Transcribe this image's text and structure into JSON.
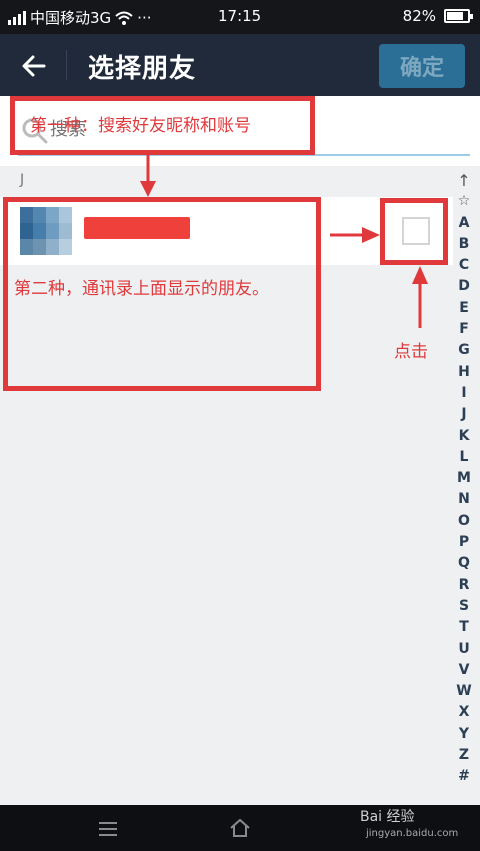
{
  "status_bar": {
    "carrier": "中国移动3G",
    "wifi_icon": "wifi-icon",
    "more": "···",
    "time": "17:15",
    "battery_percent": "82%",
    "battery_level": 0.82
  },
  "title_bar": {
    "back_icon": "arrow-left-icon",
    "title": "选择朋友",
    "confirm_label": "确定"
  },
  "search": {
    "placeholder": "搜索",
    "icon": "search-icon"
  },
  "contacts": {
    "section_letter": "J",
    "friends": [
      {
        "name": "",
        "selected": false
      }
    ]
  },
  "alphabet_index": [
    "↑",
    "☆",
    "A",
    "B",
    "C",
    "D",
    "E",
    "F",
    "G",
    "H",
    "I",
    "J",
    "K",
    "L",
    "M",
    "N",
    "O",
    "P",
    "Q",
    "R",
    "S",
    "T",
    "U",
    "V",
    "W",
    "X",
    "Y",
    "Z",
    "#"
  ],
  "annotations": {
    "method_one": "第一种：搜索好友昵称和账号",
    "method_two": "第二种，通讯录上面显示的朋友。",
    "click_hint": "点击"
  },
  "nav_bar": {
    "menu_icon": "menu-icon",
    "home_icon": "home-icon"
  },
  "watermark": {
    "brand": "Bai 经验",
    "url": "jingyan.baidu.com"
  },
  "colors": {
    "title_bar_bg": "#212a3a",
    "confirm_bg": "#2b6f97",
    "annotation_red": "#e0393c",
    "search_underline": "#9ccbe6"
  }
}
